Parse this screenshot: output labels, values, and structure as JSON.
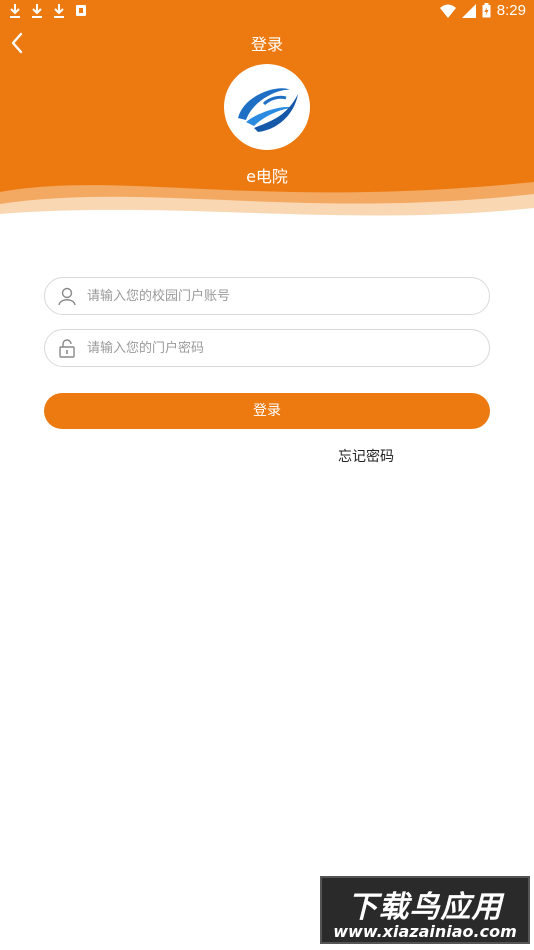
{
  "status_bar": {
    "time": "8:29",
    "left_icons": [
      "download-icon",
      "download-icon",
      "download-icon",
      "notification-app-icon"
    ],
    "right_icons": [
      "wifi-icon",
      "signal-icon",
      "battery-icon"
    ]
  },
  "header": {
    "title": "登录",
    "app_name": "e电院",
    "back_icon": "chevron-left-icon"
  },
  "form": {
    "username_placeholder": "请输入您的校园门户账号",
    "password_placeholder": "请输入您的门户密码",
    "login_label": "登录",
    "forgot_label": "忘记密码"
  },
  "watermark": {
    "top": "下载鸟应用",
    "bottom": "www.xiazainiao.com"
  },
  "colors": {
    "accent": "#ED7A11",
    "logo_blue": "#1E6FC4"
  }
}
